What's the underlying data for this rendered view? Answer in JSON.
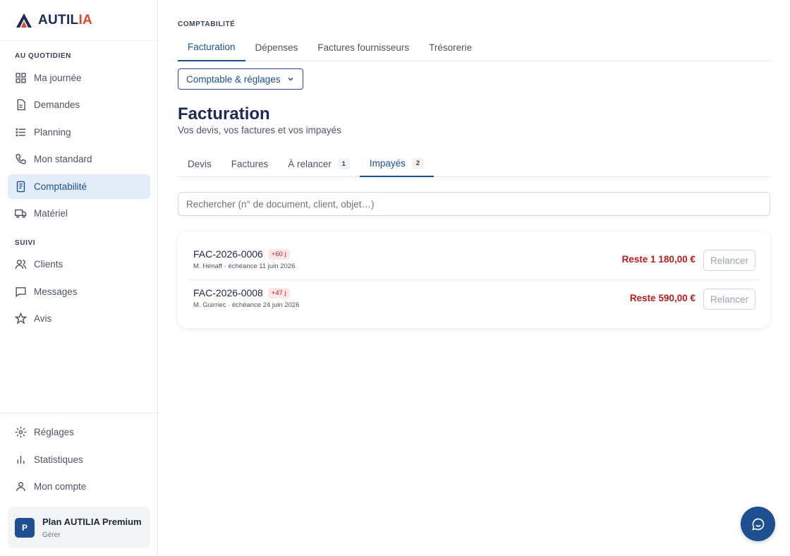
{
  "brand": {
    "name_main": "AUTIL",
    "name_accent": "IA"
  },
  "sidebar": {
    "section_daily": "AU QUOTIDIEN",
    "daily_items": [
      {
        "label": "Ma journée",
        "icon": "grid-icon"
      },
      {
        "label": "Demandes",
        "icon": "document-icon"
      },
      {
        "label": "Planning",
        "icon": "list-icon"
      },
      {
        "label": "Mon standard",
        "icon": "phone-icon"
      },
      {
        "label": "Comptabilité",
        "icon": "ledger-icon",
        "active": true
      },
      {
        "label": "Matériel",
        "icon": "truck-icon"
      }
    ],
    "section_follow": "SUIVI",
    "follow_items": [
      {
        "label": "Clients",
        "icon": "users-icon"
      },
      {
        "label": "Messages",
        "icon": "chat-icon"
      },
      {
        "label": "Avis",
        "icon": "star-icon"
      }
    ],
    "bottom_items": [
      {
        "label": "Réglages",
        "icon": "gear-icon"
      },
      {
        "label": "Statistiques",
        "icon": "bar-chart-icon"
      },
      {
        "label": "Mon compte",
        "icon": "user-icon"
      }
    ],
    "plan": {
      "avatar": "P",
      "title": "Plan AUTILIA Premium",
      "manage": "Gérer"
    }
  },
  "main": {
    "breadcrumb": "COMPTABILITÉ",
    "top_tabs": [
      "Facturation",
      "Dépenses",
      "Factures fournisseurs",
      "Trésorerie"
    ],
    "settings_select": "Comptable & réglages",
    "title": "Facturation",
    "subtitle": "Vos devis, vos factures et vos impayés",
    "sub_tabs": [
      {
        "label": "Devis"
      },
      {
        "label": "Factures"
      },
      {
        "label": "À relancer",
        "count": "1"
      },
      {
        "label": "Impayés",
        "count": "2"
      }
    ],
    "search_placeholder": "Rechercher (n° de document, client, objet…)",
    "invoices": [
      {
        "ref": "FAC-2026-0006",
        "late": "+60 j",
        "meta": "M. Hénaff · échéance 11 juin 2026",
        "remaining": "Reste 1 180,00 €",
        "action": "Relancer"
      },
      {
        "ref": "FAC-2026-0008",
        "late": "+47 j",
        "meta": "M. Guirriec · échéance 24 juin 2026",
        "remaining": "Reste 590,00 €",
        "action": "Relancer"
      }
    ]
  },
  "colors": {
    "primary": "#1d4f91",
    "danger": "#b91c1c",
    "active_bg": "#e3ecf8",
    "brand_accent": "#e0442b"
  }
}
